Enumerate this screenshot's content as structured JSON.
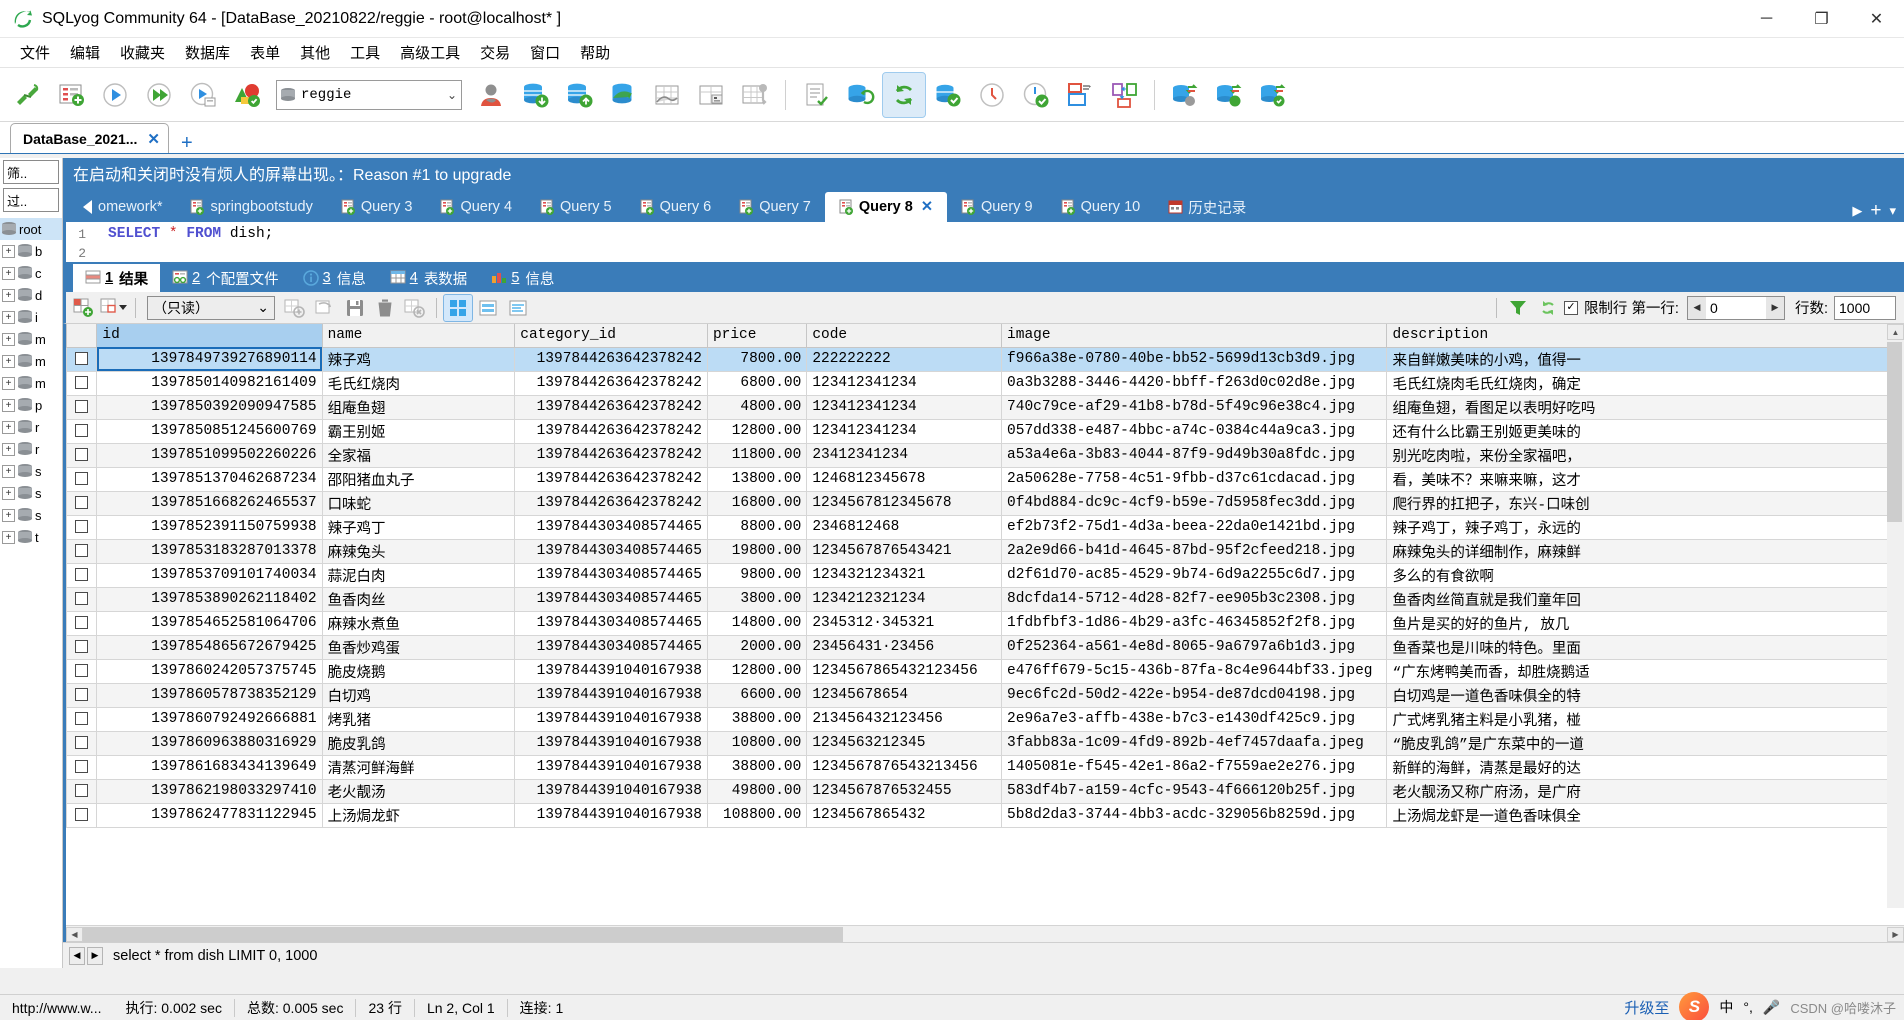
{
  "window": {
    "title": "SQLyog Community 64 - [DataBase_20210822/reggie - root@localhost* ]",
    "minimize": "─",
    "maximize": "❐",
    "close": "✕"
  },
  "menu": {
    "items": [
      "文件",
      "编辑",
      "收藏夹",
      "数据库",
      "表单",
      "其他",
      "工具",
      "高级工具",
      "交易",
      "窗口",
      "帮助"
    ]
  },
  "toolbar": {
    "db_name": "reggie",
    "chevron": "⌄"
  },
  "connection_tabs": {
    "tabs": [
      {
        "label": "DataBase_2021...",
        "close": "✕"
      }
    ],
    "add": "+"
  },
  "sidebar": {
    "filter1": "筛..",
    "filter2": "过..",
    "root": "root",
    "nodes": [
      {
        "label": "b"
      },
      {
        "label": "c"
      },
      {
        "label": "d"
      },
      {
        "label": "i"
      },
      {
        "label": "m"
      },
      {
        "label": "m"
      },
      {
        "label": "m"
      },
      {
        "label": "p"
      },
      {
        "label": "r"
      },
      {
        "label": "r"
      },
      {
        "label": "s"
      },
      {
        "label": "s"
      },
      {
        "label": "s"
      },
      {
        "label": "t"
      }
    ],
    "expander": "+"
  },
  "banner": {
    "text": "在启动和关闭时没有烦人的屏幕出现。：Reason #1 to upgrade"
  },
  "query_tabs": {
    "back_tab": "omework*",
    "tabs": [
      {
        "label": "springbootstudy",
        "selected": false
      },
      {
        "label": "Query 3",
        "selected": false
      },
      {
        "label": "Query 4",
        "selected": false
      },
      {
        "label": "Query 5",
        "selected": false
      },
      {
        "label": "Query 6",
        "selected": false
      },
      {
        "label": "Query 7",
        "selected": false
      },
      {
        "label": "Query 8",
        "selected": true,
        "close": "✕"
      },
      {
        "label": "Query 9",
        "selected": false
      },
      {
        "label": "Query 10",
        "selected": false
      }
    ],
    "history_label": "历史记录",
    "forward": "▶",
    "add": "+",
    "more": "▾"
  },
  "editor": {
    "line_number": "1",
    "line_number2": "2",
    "sql_keyword1": "SELECT",
    "sql_star": "*",
    "sql_keyword2": "FROM",
    "sql_table": "dish;"
  },
  "result_tabs": [
    {
      "num": "1",
      "label": "结果",
      "selected": true
    },
    {
      "num": "2",
      "label": "个配置文件",
      "selected": false
    },
    {
      "num": "3",
      "label": "信息",
      "selected": false
    },
    {
      "num": "4",
      "label": "表数据",
      "selected": false
    },
    {
      "num": "5",
      "label": "信息",
      "selected": false
    }
  ],
  "grid_toolbar": {
    "readonly_label": "（只读）",
    "chevron": "⌄",
    "limit_checkbox": "✓",
    "limit_label": "限制行",
    "first_row_label": "第一行:",
    "first_row_value": "0",
    "rows_label": "行数:",
    "rows_value": "1000",
    "left_arrow": "◀",
    "right_arrow": "▶"
  },
  "grid": {
    "columns": [
      "id",
      "name",
      "category_id",
      "price",
      "code",
      "image",
      "description"
    ],
    "rows": [
      {
        "id": "1397849739276890114",
        "name": "辣子鸡",
        "category_id": "1397844263642378242",
        "price": "7800.00",
        "code": "222222222",
        "image": "f966a38e-0780-40be-bb52-5699d13cb3d9.jpg",
        "description": "来自鲜嫩美味的小鸡，值得一"
      },
      {
        "id": "1397850140982161409",
        "name": "毛氏红烧肉",
        "category_id": "1397844263642378242",
        "price": "6800.00",
        "code": "123412341234",
        "image": "0a3b3288-3446-4420-bbff-f263d0c02d8e.jpg",
        "description": "毛氏红烧肉毛氏红烧肉，确定"
      },
      {
        "id": "1397850392090947585",
        "name": "组庵鱼翅",
        "category_id": "1397844263642378242",
        "price": "4800.00",
        "code": "123412341234",
        "image": "740c79ce-af29-41b8-b78d-5f49c96e38c4.jpg",
        "description": "组庵鱼翅，看图足以表明好吃吗"
      },
      {
        "id": "1397850851245600769",
        "name": "霸王别姬",
        "category_id": "1397844263642378242",
        "price": "12800.00",
        "code": "123412341234",
        "image": "057dd338-e487-4bbc-a74c-0384c44a9ca3.jpg",
        "description": "还有什么比霸王别姬更美味的"
      },
      {
        "id": "1397851099502260226",
        "name": "全家福",
        "category_id": "1397844263642378242",
        "price": "11800.00",
        "code": "23412341234",
        "image": "a53a4e6a-3b83-4044-87f9-9d49b30a8fdc.jpg",
        "description": "别光吃肉啦，来份全家福吧，"
      },
      {
        "id": "1397851370462687234",
        "name": "邵阳猪血丸子",
        "category_id": "1397844263642378242",
        "price": "13800.00",
        "code": "1246812345678",
        "image": "2a50628e-7758-4c51-9fbb-d37c61cdacad.jpg",
        "description": "看，美味不？来嘛来嘛，这才"
      },
      {
        "id": "1397851668262465537",
        "name": "口味蛇",
        "category_id": "1397844263642378242",
        "price": "16800.00",
        "code": "1234567812345678",
        "image": "0f4bd884-dc9c-4cf9-b59e-7d5958fec3dd.jpg",
        "description": "爬行界的扛把子，东兴-口味创"
      },
      {
        "id": "1397852391150759938",
        "name": "辣子鸡丁",
        "category_id": "1397844303408574465",
        "price": "8800.00",
        "code": "2346812468",
        "image": "ef2b73f2-75d1-4d3a-beea-22da0e1421bd.jpg",
        "description": "辣子鸡丁，辣子鸡丁，永远的"
      },
      {
        "id": "1397853183287013378",
        "name": "麻辣兔头",
        "category_id": "1397844303408574465",
        "price": "19800.00",
        "code": "1234567876543421",
        "image": "2a2e9d66-b41d-4645-87bd-95f2cfeed218.jpg",
        "description": "麻辣兔头的详细制作，麻辣鲜"
      },
      {
        "id": "1397853709101740034",
        "name": "蒜泥白肉",
        "category_id": "1397844303408574465",
        "price": "9800.00",
        "code": "1234321234321",
        "image": "d2f61d70-ac85-4529-9b74-6d9a2255c6d7.jpg",
        "description": "多么的有食欲啊"
      },
      {
        "id": "1397853890262118402",
        "name": "鱼香肉丝",
        "category_id": "1397844303408574465",
        "price": "3800.00",
        "code": "1234212321234",
        "image": "8dcfda14-5712-4d28-82f7-ee905b3c2308.jpg",
        "description": "鱼香肉丝简直就是我们童年回"
      },
      {
        "id": "1397854652581064706",
        "name": "麻辣水煮鱼",
        "category_id": "1397844303408574465",
        "price": "14800.00",
        "code": "2345312·345321",
        "image": "1fdbfbf3-1d86-4b29-a3fc-46345852f2f8.jpg",
        "description": "鱼片是买的好的鱼片, 放几"
      },
      {
        "id": "1397854865672679425",
        "name": "鱼香炒鸡蛋",
        "category_id": "1397844303408574465",
        "price": "2000.00",
        "code": "23456431·23456",
        "image": "0f252364-a561-4e8d-8065-9a6797a6b1d3.jpg",
        "description": "鱼香菜也是川味的特色。里面"
      },
      {
        "id": "1397860242057375745",
        "name": "脆皮烧鹅",
        "category_id": "1397844391040167938",
        "price": "12800.00",
        "code": "1234567865432123456",
        "image": "e476ff679-5c15-436b-87fa-8c4e9644bf33.jpeg",
        "description": "“广东烤鸭美而香，却胜烧鹅适"
      },
      {
        "id": "1397860578738352129",
        "name": "白切鸡",
        "category_id": "1397844391040167938",
        "price": "6600.00",
        "code": "12345678654",
        "image": "9ec6fc2d-50d2-422e-b954-de87dcd04198.jpg",
        "description": "白切鸡是一道色香味俱全的特"
      },
      {
        "id": "1397860792492666881",
        "name": "烤乳猪",
        "category_id": "1397844391040167938",
        "price": "38800.00",
        "code": "213456432123456",
        "image": "2e96a7e3-affb-438e-b7c3-e1430df425c9.jpg",
        "description": "广式烤乳猪主料是小乳猪，椪"
      },
      {
        "id": "1397860963880316929",
        "name": "脆皮乳鸽",
        "category_id": "1397844391040167938",
        "price": "10800.00",
        "code": "1234563212345",
        "image": "3fabb83a-1c09-4fd9-892b-4ef7457daafa.jpeg",
        "description": "“脆皮乳鸽”是广东菜中的一道"
      },
      {
        "id": "1397861683434139649",
        "name": "清蒸河鲜海鲜",
        "category_id": "1397844391040167938",
        "price": "38800.00",
        "code": "1234567876543213456",
        "image": "1405081e-f545-42e1-86a2-f7559ae2e276.jpg",
        "description": "新鲜的海鲜，清蒸是最好的达"
      },
      {
        "id": "1397862198033297410",
        "name": "老火靓汤",
        "category_id": "1397844391040167938",
        "price": "49800.00",
        "code": "1234567876532455",
        "image": "583df4b7-a159-4cfc-9543-4f666120b25f.jpg",
        "description": "老火靓汤又称广府汤，是广府"
      },
      {
        "id": "1397862477831122945",
        "name": "上汤焗龙虾",
        "category_id": "1397844391040167938",
        "price": "108800.00",
        "code": "1234567865432",
        "image": "5b8d2da3-3744-4bb3-acdc-329056b8259d.jpg",
        "description": "上汤焗龙虾是一道色香味俱全"
      }
    ]
  },
  "sql_status": {
    "text": "select * from dish LIMIT 0, 1000",
    "prev": "◀",
    "next": "▶"
  },
  "statusbar": {
    "connection": "http://www.w...",
    "exec_time": "执行: 0.002 sec",
    "total_time": "总数: 0.005 sec",
    "row_count": "23 行",
    "cursor_pos": "Ln 2, Col 1",
    "conn_num": "连接: 1",
    "upgrade": "升级至",
    "ime_mode": "中",
    "watermark": "CSDN @哈喽沐子"
  },
  "colors": {
    "accent_blue": "#3a7cb9",
    "selection": "#bcdcf5",
    "header_bg": "#f1f1f1",
    "toolbar_bg": "#ffffff"
  }
}
